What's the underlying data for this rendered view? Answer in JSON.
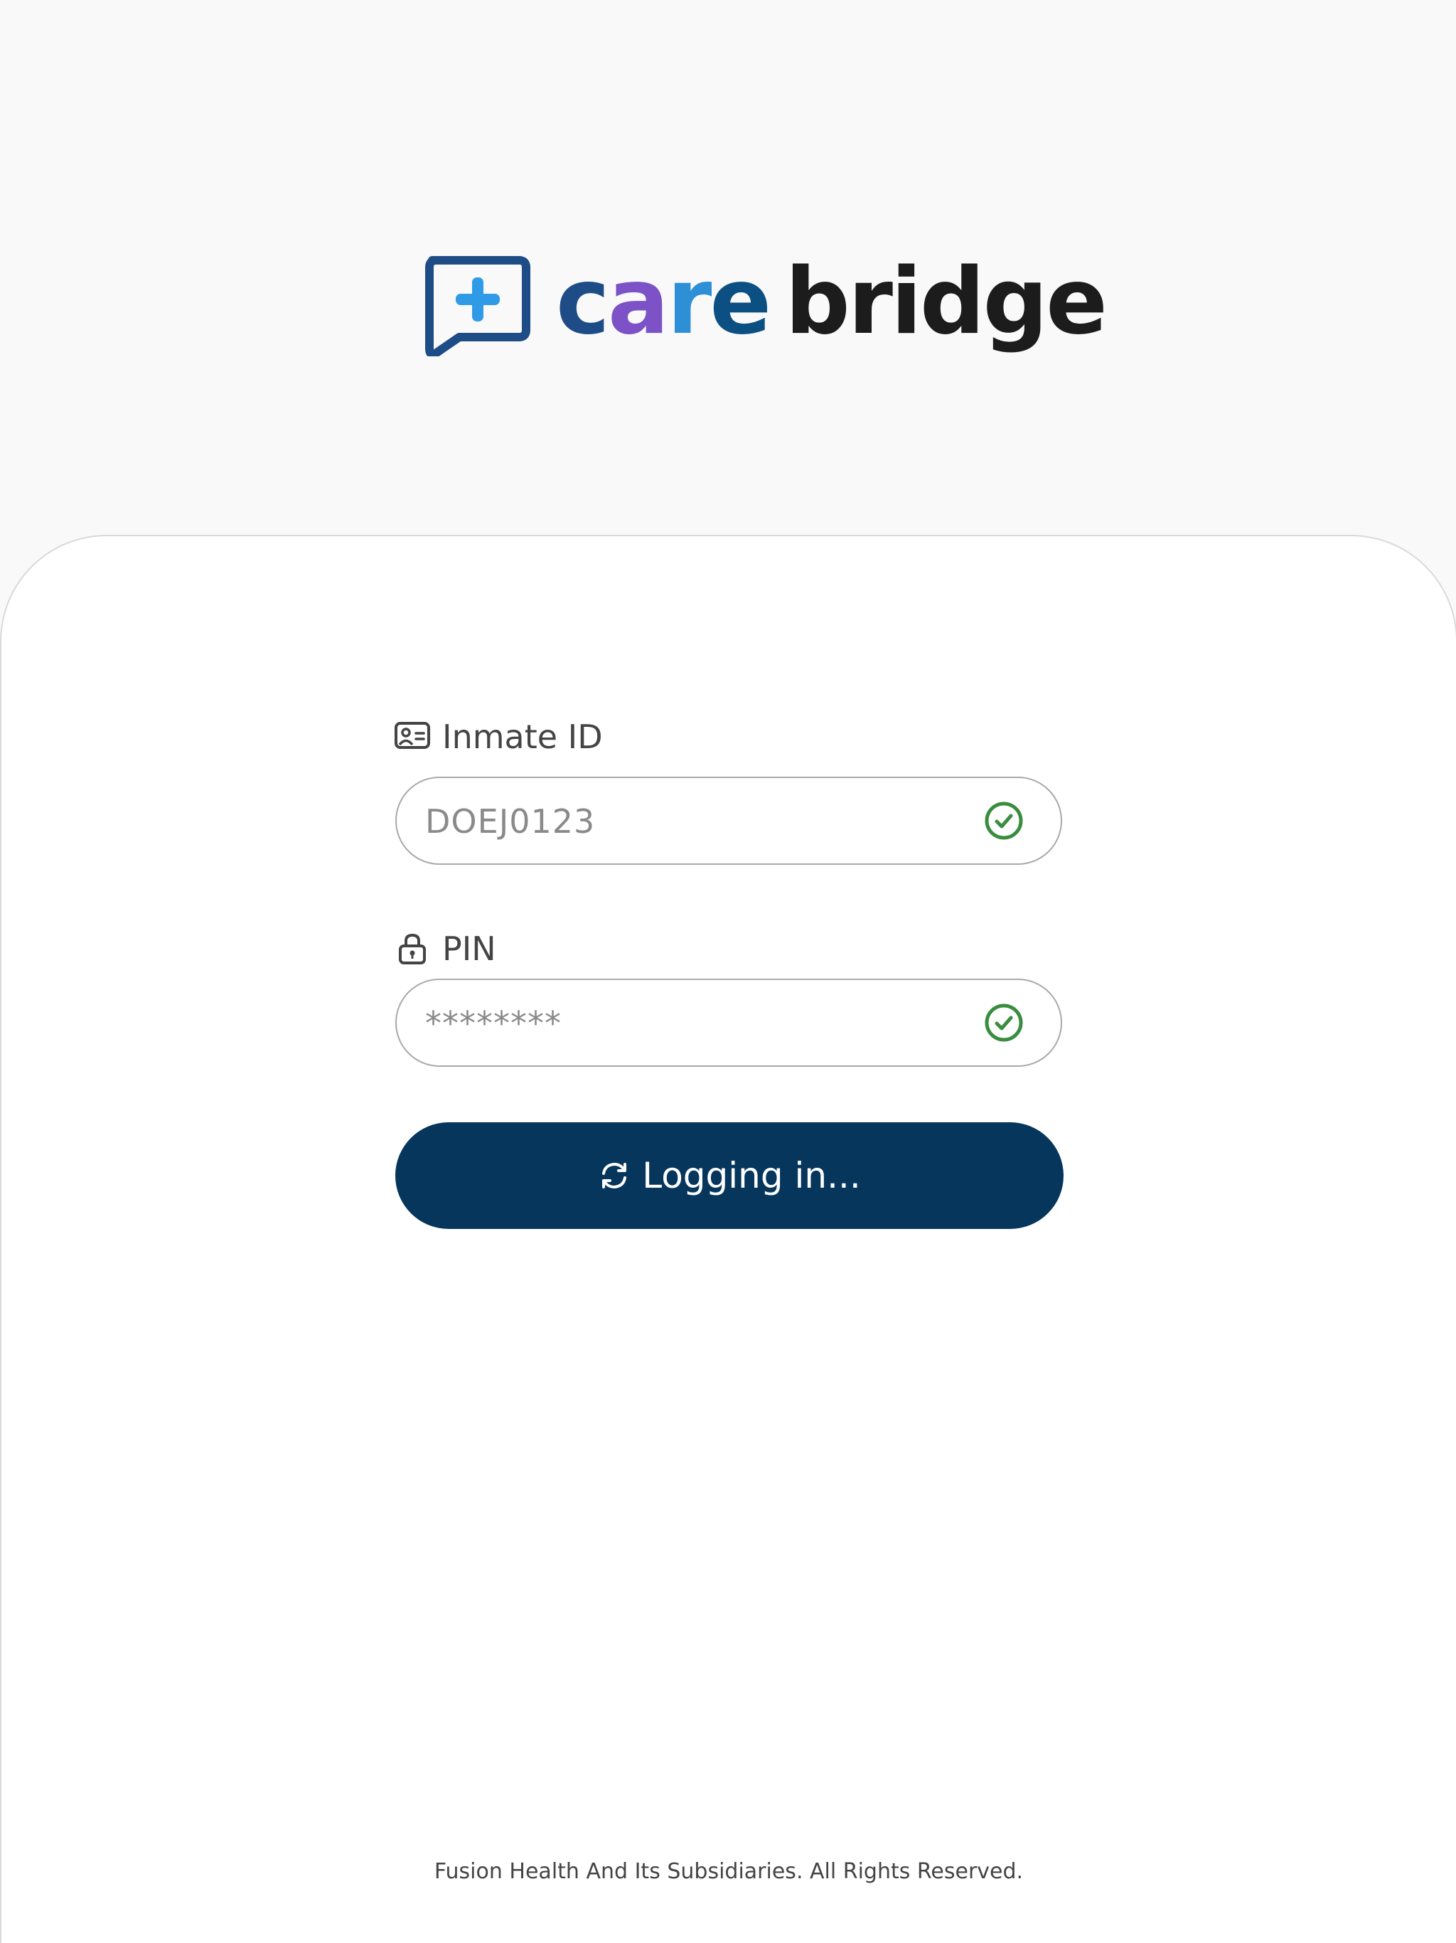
{
  "logo": {
    "icon": "chat-plus-icon",
    "word_care": [
      "c",
      "a",
      "r",
      "e"
    ],
    "word_bridge": "bridge",
    "colors": {
      "icon_frame": "#1d4c86",
      "icon_plus": "#2f9be6",
      "c": "#1d4c86",
      "a": "#7c52c6",
      "r": "#2f8fd6",
      "e": "#0c4f82",
      "bridge": "#1c1c1c"
    }
  },
  "form": {
    "inmate_id": {
      "label": "Inmate ID",
      "icon": "id-card-icon",
      "value": "DOEJ0123",
      "status_icon": "check-circle-icon"
    },
    "pin": {
      "label": "PIN",
      "icon": "lock-icon",
      "value": "********",
      "status_icon": "check-circle-icon"
    },
    "submit": {
      "label": "Logging in...",
      "icon": "refresh-icon",
      "color": "#06365c"
    }
  },
  "colors": {
    "valid": "#3a8c3f",
    "page_bg": "#f9f9f9",
    "card_bg": "#ffffff"
  },
  "footer": {
    "text": "Fusion Health And Its Subsidiaries. All Rights Reserved."
  }
}
